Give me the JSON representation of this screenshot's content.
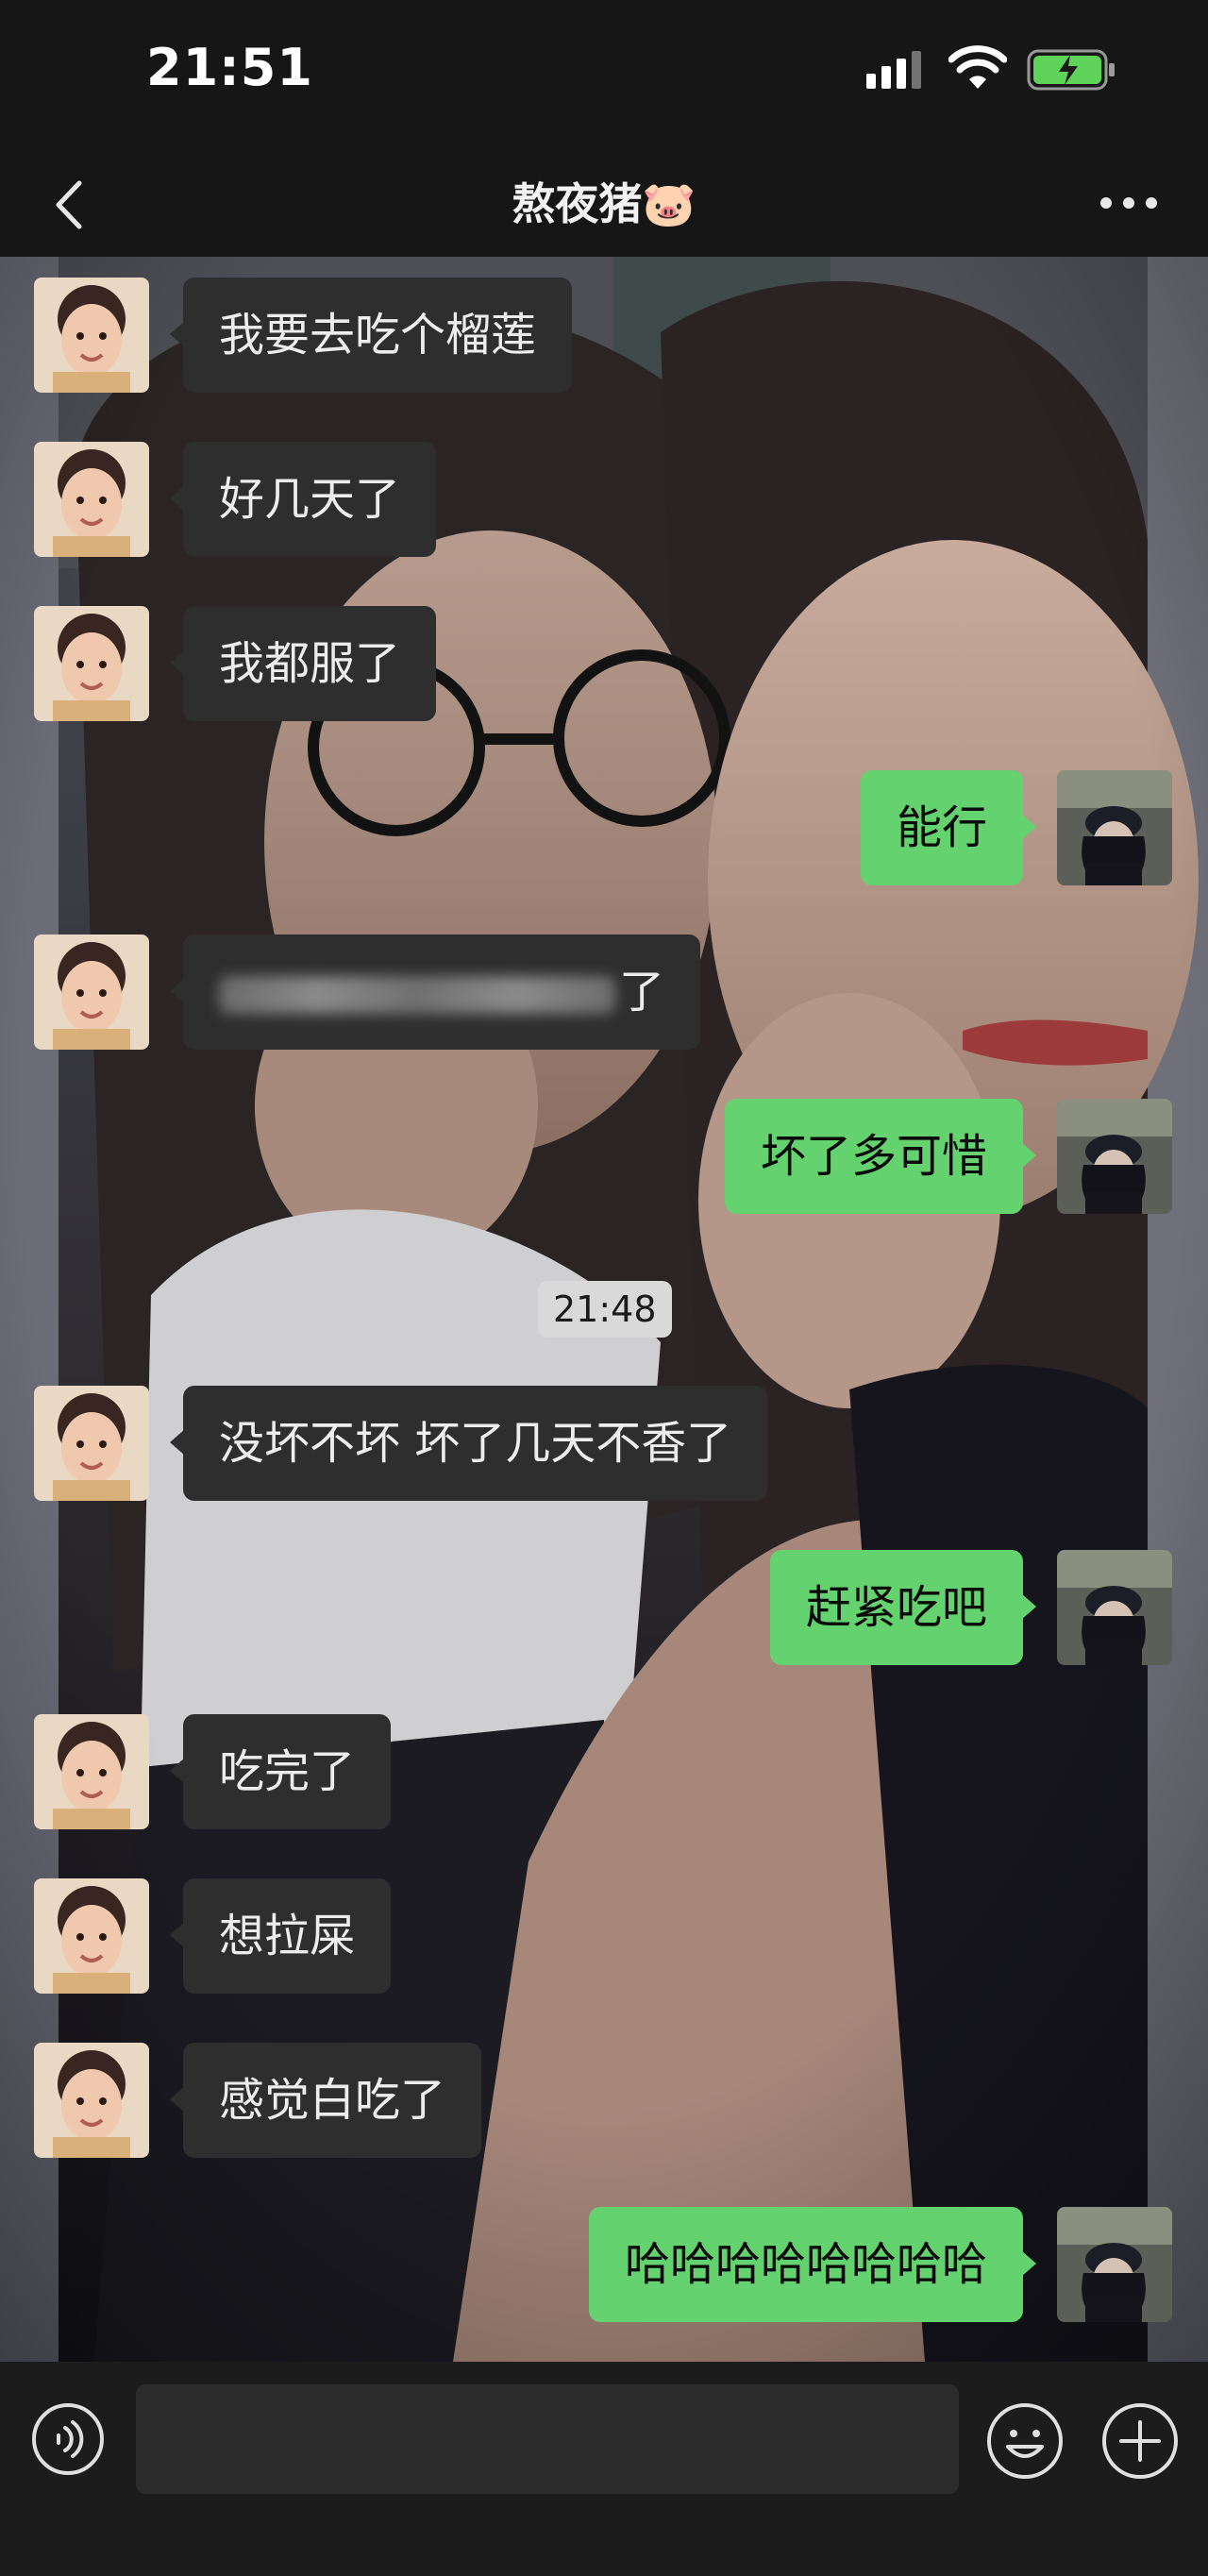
{
  "status_bar": {
    "time": "21:51",
    "icons": [
      "cellular-signal-icon",
      "wifi-icon",
      "battery-charging-icon"
    ]
  },
  "header": {
    "title": "熬夜猪🐷",
    "icons": [
      "back-chevron-icon",
      "more-dots-icon"
    ]
  },
  "messages": [
    {
      "side": "in",
      "text": "我要去吃个榴莲"
    },
    {
      "side": "in",
      "text": "好几天了"
    },
    {
      "side": "in",
      "text": "我都服了"
    },
    {
      "side": "out",
      "text": "能行"
    },
    {
      "side": "in",
      "text": "了",
      "blurred_prefix": true
    },
    {
      "side": "out",
      "text": "坏了多可惜"
    },
    {
      "side": "in",
      "text": "没坏不坏 坏了几天不香了"
    },
    {
      "side": "out",
      "text": "赶紧吃吧"
    },
    {
      "side": "in",
      "text": "吃完了"
    },
    {
      "side": "in",
      "text": "想拉屎"
    },
    {
      "side": "in",
      "text": "感觉白吃了"
    },
    {
      "side": "out",
      "text": "哈哈哈哈哈哈哈哈"
    }
  ],
  "timestamp": "21:48",
  "input_bar": {
    "value": "",
    "icons": [
      "voice-icon",
      "emoji-icon",
      "plus-icon"
    ]
  },
  "colors": {
    "outgoing_bubble": "#63d26f",
    "incoming_bubble": "#2e2e2e",
    "bars": "#161616"
  }
}
